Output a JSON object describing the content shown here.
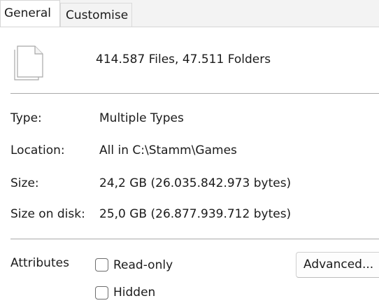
{
  "tabs": [
    {
      "label": "General"
    },
    {
      "label": "Customise"
    }
  ],
  "summary": {
    "text": "414.587 Files, 47.511 Folders",
    "icon": "file-stack-icon"
  },
  "properties": {
    "type": {
      "label": "Type:",
      "value": "Multiple Types"
    },
    "location": {
      "label": "Location:",
      "value": "All in C:\\Stamm\\Games"
    },
    "size": {
      "label": "Size:",
      "value": "24,2 GB (26.035.842.973 bytes)"
    },
    "size_on_disk": {
      "label": "Size on disk:",
      "value": "25,0 GB (26.877.939.712 bytes)"
    }
  },
  "attributes": {
    "label": "Attributes",
    "read_only": {
      "label": "Read-only",
      "checked": false
    },
    "hidden": {
      "label": "Hidden",
      "checked": false
    },
    "advanced_button": "Advanced..."
  }
}
